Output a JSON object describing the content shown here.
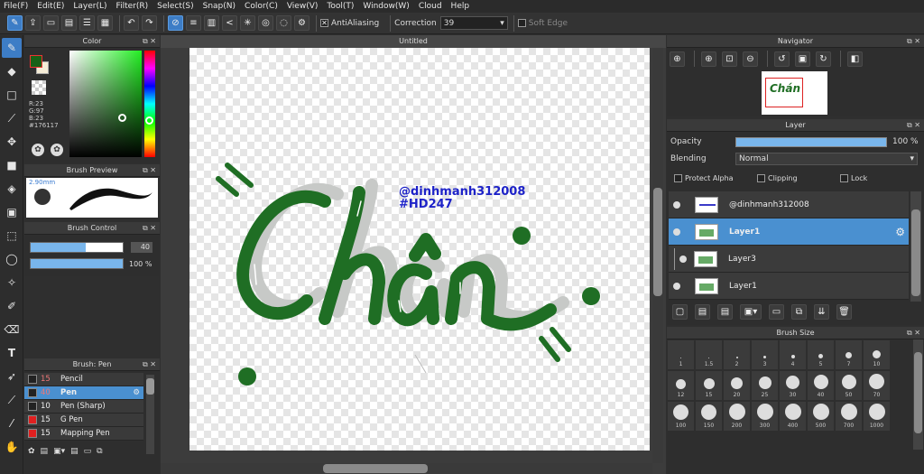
{
  "menu": [
    "File(F)",
    "Edit(E)",
    "Layer(L)",
    "Filter(R)",
    "Select(S)",
    "Snap(N)",
    "Color(C)",
    "View(V)",
    "Tool(T)",
    "Window(W)",
    "Cloud",
    "Help"
  ],
  "toolbar": {
    "antialiasing_label": "AntiAliasing",
    "correction_label": "Correction",
    "correction_value": "39",
    "soft_edge_label": "Soft Edge"
  },
  "color_panel": {
    "title": "Color",
    "r": "R:23",
    "g": "G:97",
    "b": "B:23",
    "hex": "#176117",
    "main_color": "#176117",
    "sub_color": "#f5ecd6"
  },
  "brush_preview": {
    "title": "Brush Preview",
    "size": "2.90mm"
  },
  "brush_control": {
    "title": "Brush Control",
    "size_value": "40",
    "size_fraction": 0.6,
    "opacity_value": "100 %",
    "opacity_fraction": 1.0
  },
  "brush_list": {
    "title": "Brush: Pen",
    "items": [
      {
        "num": "15",
        "name": "Pencil",
        "color": "#222222"
      },
      {
        "num": "40",
        "name": "Pen",
        "color": "#222222"
      },
      {
        "num": "10",
        "name": "Pen (Sharp)",
        "color": "#222222"
      },
      {
        "num": "15",
        "name": "G Pen",
        "color": "#e02020"
      },
      {
        "num": "15",
        "name": "Mapping Pen",
        "color": "#e02020"
      }
    ]
  },
  "canvas": {
    "title": "Untitled",
    "text_line1": "@dinhmanh312008",
    "text_line2": "#HD247",
    "lettering": "Chán"
  },
  "navigator": {
    "title": "Navigator"
  },
  "layer_panel": {
    "title": "Layer",
    "opacity_label": "Opacity",
    "opacity_value": "100 %",
    "blending_label": "Blending",
    "blending_value": "Normal",
    "protect_alpha": "Protect Alpha",
    "clipping": "Clipping",
    "lock": "Lock",
    "layers": [
      {
        "name": "@dinhmanh312008"
      },
      {
        "name": "Layer1"
      },
      {
        "name": "Layer3"
      },
      {
        "name": "Layer1"
      }
    ]
  },
  "brush_size": {
    "title": "Brush Size",
    "sizes": [
      "1",
      "1.5",
      "2",
      "3",
      "4",
      "5",
      "7",
      "10",
      "12",
      "15",
      "20",
      "25",
      "30",
      "40",
      "50",
      "70",
      "100",
      "150",
      "200",
      "300",
      "400",
      "500",
      "700",
      "1000"
    ]
  }
}
